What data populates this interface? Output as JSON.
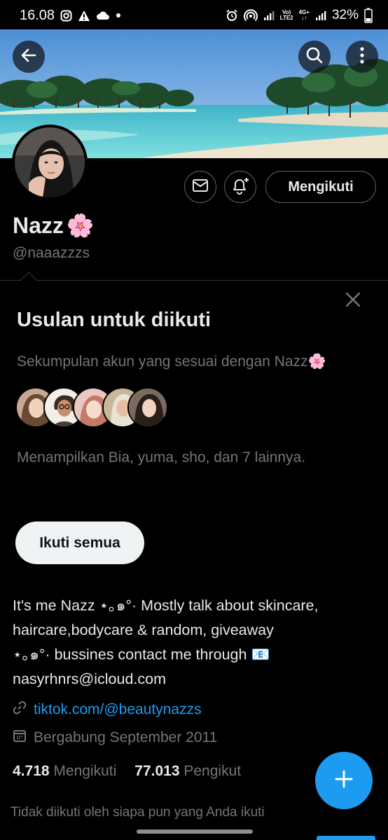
{
  "status_bar": {
    "time": "16.08",
    "network_volte": "Vo)",
    "network_lte": "LTE2",
    "network_4g": "4G+",
    "battery_percent": "32%",
    "icons": [
      "instagram-icon",
      "warning-icon",
      "cloud-icon",
      "dot-icon",
      "alarm-icon",
      "hotspot-icon",
      "signal-icon",
      "battery-icon"
    ]
  },
  "header": {
    "back_icon": "arrow-left-icon",
    "search_icon": "search-icon",
    "more_icon": "more-vertical-icon"
  },
  "profile": {
    "display_name": "Nazz",
    "name_emoji": "🌸",
    "handle": "@naaazzzs",
    "follow_state_label": "Mengikuti",
    "message_icon": "envelope-icon",
    "notify_icon": "bell-plus-icon"
  },
  "suggestions": {
    "title": "Usulan untuk diikuti",
    "subtitle": "Sekumpulan akun yang sesuai dengan Nazz🌸",
    "showing_text": "Menampilkan Bia, yuma, sho, dan 7 lainnya.",
    "follow_all_label": "Ikuti semua",
    "close_icon": "close-icon"
  },
  "bio": {
    "lines": [
      "It's me Nazz ⋆｡๑°· Mostly talk about skincare,",
      "haircare,bodycare & random, giveaway",
      "⋆｡๑°· bussines contact me through 📧",
      "nasyrhnrs@icloud.com"
    ]
  },
  "meta": {
    "link": "tiktok.com/@beautynazzs",
    "joined": "Bergabung September 2011"
  },
  "stats": {
    "following_count": "4.718",
    "following_label": "Mengikuti",
    "followers_count": "77.013",
    "followers_label": "Pengikut"
  },
  "followed_by_text": "Tidak diikuti oleh siapa pun yang Anda ikuti",
  "colors": {
    "accent": "#1d9bf0",
    "background": "#000000",
    "muted_text": "#71767b",
    "primary_text": "#e7e9ea",
    "border": "#536471"
  }
}
